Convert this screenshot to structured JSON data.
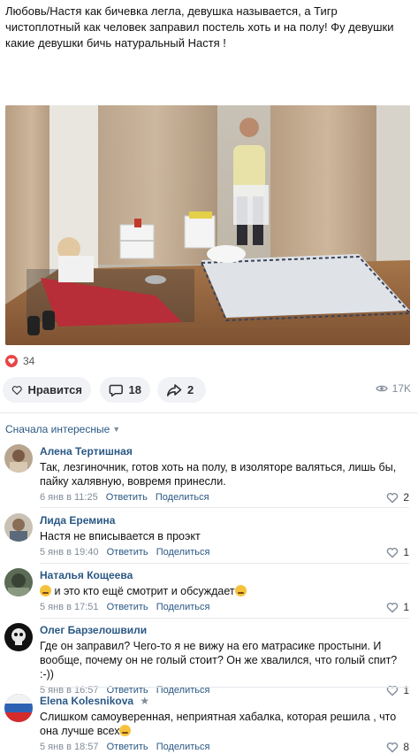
{
  "post": {
    "text": "Любовь/Настя как бичевка легла, девушка называется, а Тигр чистоплотный как человек заправил постель хоть и на полу! Фу девушки какие девушки бичь натуральный Настя !"
  },
  "reactions": {
    "count": "34",
    "icon": "heart-icon",
    "color": "#e64646"
  },
  "actions": {
    "like_label": "Нравится",
    "comments_count": "18",
    "shares_count": "2",
    "views_count": "17K"
  },
  "comments_sort": {
    "label": "Сначала интересные"
  },
  "comments": [
    {
      "author": "Алена Тертишная",
      "text": "Так, лезгиночник, готов хоть на полу, в изоляторе валяться, лишь бы, пайку халявную, вовремя принесли.",
      "date": "6 янв в 11:25",
      "reply": "Ответить",
      "share": "Поделиться",
      "likes": "2"
    },
    {
      "author": "Лида Еремина",
      "text": "Настя не вписывается в проэкт",
      "date": "5 янв в 19:40",
      "reply": "Ответить",
      "share": "Поделиться",
      "likes": "1"
    },
    {
      "author": "Наталья Кощеева",
      "text": "и это кто ещё смотрит и обсуждает",
      "date": "5 янв в 17:51",
      "reply": "Ответить",
      "share": "Поделиться",
      "likes": "1"
    },
    {
      "author": "Олег Барзелошвили",
      "text": "Где он заправил? Чего-то я не вижу на его матрасике простыни. И вообще, почему он не голый стоит? Он же хвалился, что голый спит? :-))",
      "date": "5 янв в 16:57",
      "reply": "Ответить",
      "share": "Поделиться",
      "likes": "1"
    },
    {
      "author": "Elena Kolesnikova",
      "text": "Слишком самоуверенная, неприятная хабалка, которая решила , что она лучше всех",
      "date": "5 янв в 18:57",
      "reply": "Ответить",
      "share": "Поделиться",
      "likes": "8"
    }
  ],
  "colors": {
    "link": "#2a5885",
    "muted": "#818c99",
    "pill_bg": "#f0f2f5"
  }
}
